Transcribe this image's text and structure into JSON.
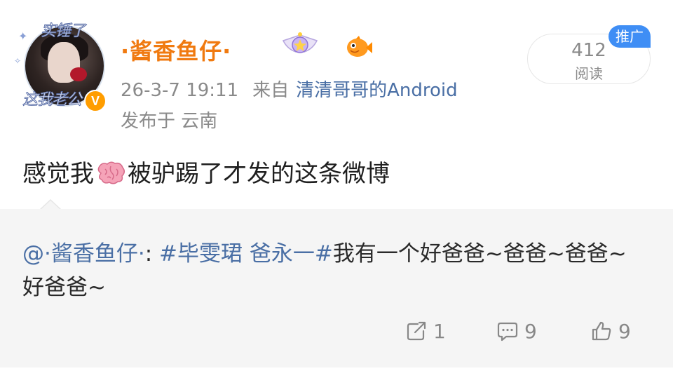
{
  "post": {
    "author": {
      "name": "·酱香鱼仔·",
      "avatar_frame_top": "实锤了",
      "avatar_frame_bottom": "这我老公",
      "verify_mark": "V"
    },
    "timestamp": "26-3-7 19:11",
    "source_prefix": "来自",
    "source": "清清哥哥的Android",
    "location": "发布于 云南",
    "read_count": "412",
    "read_label": "阅读",
    "promo_tag": "推广",
    "text_before_emoji": "感觉我",
    "text_after_emoji": "被驴踢了才发的这条微博",
    "emoji": "brain-icon"
  },
  "quote": {
    "mention": "@·酱香鱼仔·",
    "colon": ": ",
    "hashtag": "#毕雯珺 爸永一#",
    "text": "我有一个好爸爸~爸爸~爸爸~好爸爸~"
  },
  "actions": {
    "repost_count": "1",
    "comment_count": "9",
    "like_count": "9"
  },
  "colors": {
    "username": "#f07a10",
    "link": "#4a6fa5",
    "promo": "#3f8ef5",
    "quote_bg": "#f5f5f5"
  }
}
